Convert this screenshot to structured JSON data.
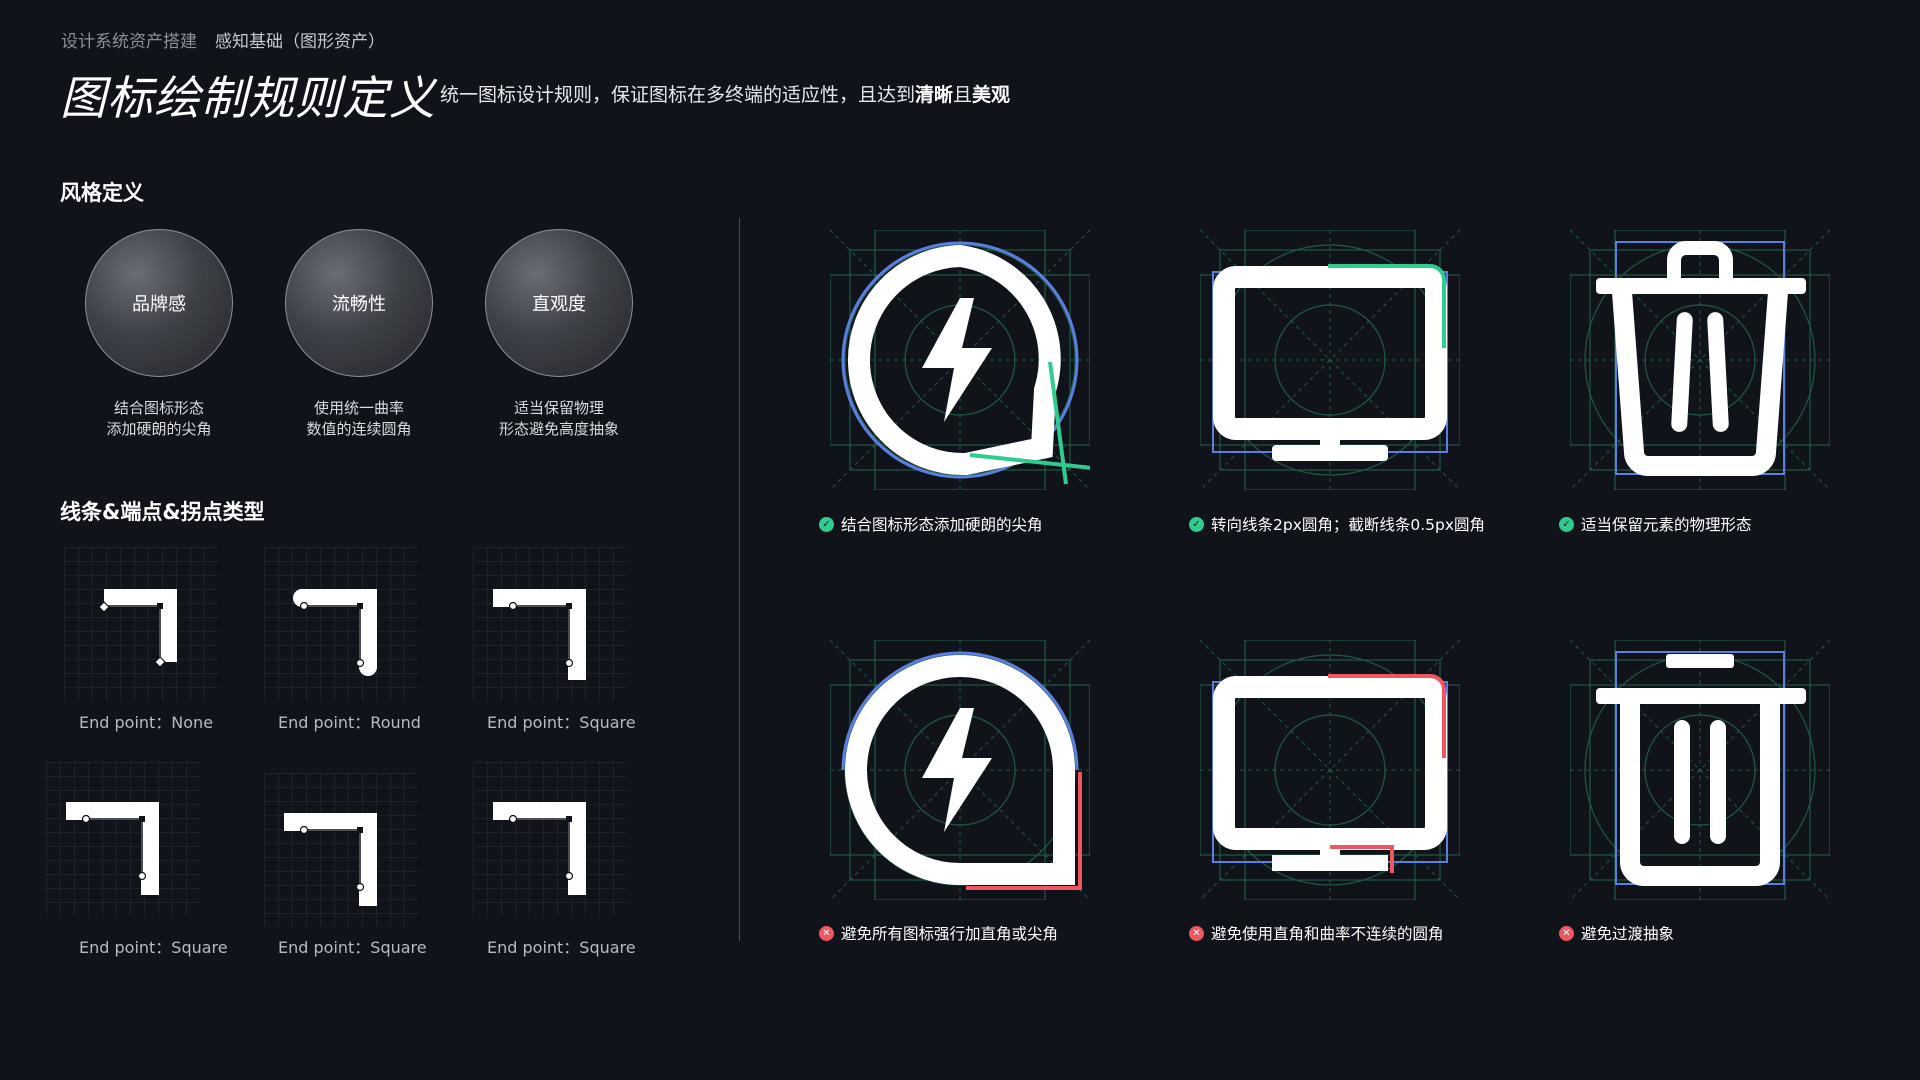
{
  "breadcrumb": {
    "parent": "设计系统资产搭建",
    "current": "感知基础（图形资产）"
  },
  "title": "图标绘制规则定义",
  "subtitle": {
    "prefix": "统一图标设计规则，保证图标在多终端的适应性，且达到",
    "bold1": "清晰",
    "mid": "且",
    "bold2": "美观"
  },
  "style_section": {
    "heading": "风格定义",
    "items": [
      {
        "label": "品牌感",
        "desc1": "结合图标形态",
        "desc2": "添加硬朗的尖角"
      },
      {
        "label": "流畅性",
        "desc1": "使用统一曲率",
        "desc2": "数值的连续圆角"
      },
      {
        "label": "直观度",
        "desc1": "适当保留物理",
        "desc2": "形态避免高度抽象"
      }
    ]
  },
  "stroke_section": {
    "heading": "线条&端点&拐点类型",
    "items": [
      {
        "label": "End point：None"
      },
      {
        "label": "End point：Round"
      },
      {
        "label": "End point：Square"
      },
      {
        "label": "End point：Square"
      },
      {
        "label": "End point：Square"
      },
      {
        "label": "End point：Square"
      }
    ]
  },
  "examples": {
    "good": [
      {
        "caption": "结合图标形态添加硬朗的尖角",
        "icon": "lightning-bubble-icon"
      },
      {
        "caption": "转向线条2px圆角；截断线条0.5px圆角",
        "icon": "monitor-icon"
      },
      {
        "caption": "适当保留元素的物理形态",
        "icon": "trash-icon"
      }
    ],
    "bad": [
      {
        "caption": "避免所有图标强行加直角或尖角",
        "icon": "lightning-bubble-icon"
      },
      {
        "caption": "避免使用直角和曲率不连续的圆角",
        "icon": "monitor-icon"
      },
      {
        "caption": "避免过渡抽象",
        "icon": "trash-icon"
      }
    ]
  },
  "colors": {
    "background": "#10131a",
    "good": "#2ecc8f",
    "bad": "#f1555f",
    "guide_blue": "#5b7fe0",
    "guide_green": "#1f5a46"
  }
}
